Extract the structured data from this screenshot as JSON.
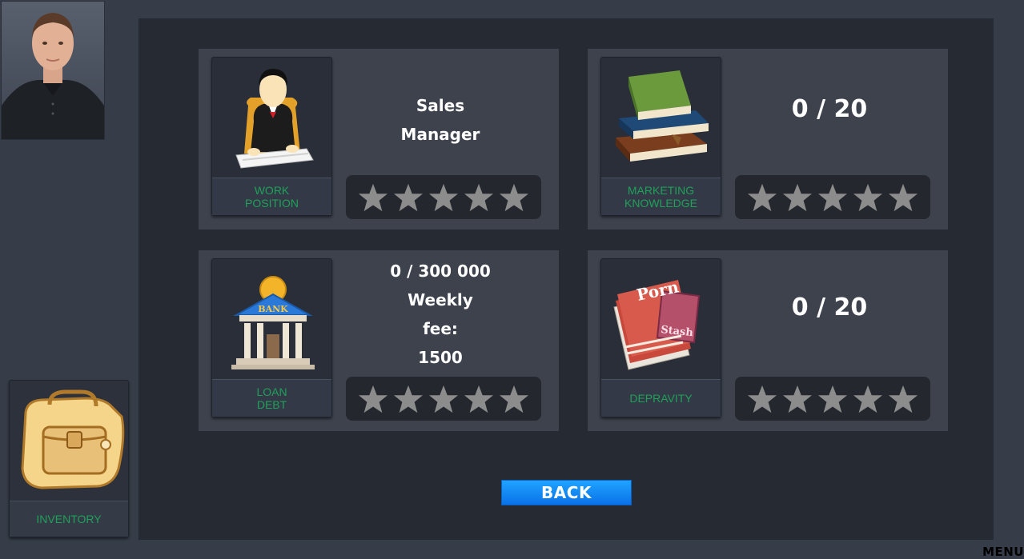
{
  "player": {
    "portrait_icon": "player-portrait"
  },
  "sidebar": {
    "inventory_label": "INVENTORY",
    "inventory_icon": "backpack-icon"
  },
  "cards": {
    "work": {
      "label_line1": "WORK",
      "label_line2": "POSITION",
      "value_line1": "Sales",
      "value_line2": "Manager",
      "icon": "office-worker-icon",
      "rating": 0,
      "max_rating": 5
    },
    "marketing": {
      "label_line1": "MARKETING",
      "label_line2": "KNOWLEDGE",
      "value": "0 / 20",
      "icon": "books-icon",
      "rating": 0,
      "max_rating": 5
    },
    "loan": {
      "label_line1": "LOAN",
      "label_line2": "DEBT",
      "value_line1": "0 / 300 000",
      "value_line2": "Weekly",
      "value_line3": "fee:",
      "value_line4": "1500",
      "icon": "bank-icon",
      "bank_sign": "BANK",
      "rating": 0,
      "max_rating": 5
    },
    "depravity": {
      "label": "DEPRAVITY",
      "value": "0 / 20",
      "icon": "magazines-icon",
      "magazine_title": "Porn",
      "magazine_subtitle": "Stash",
      "rating": 0,
      "max_rating": 5
    }
  },
  "back_button": "BACK",
  "menu_label": "MENU",
  "colors": {
    "label_green": "#1fa15a",
    "button_blue": "#1a8ef5",
    "star_grey": "#8c8c8c"
  }
}
